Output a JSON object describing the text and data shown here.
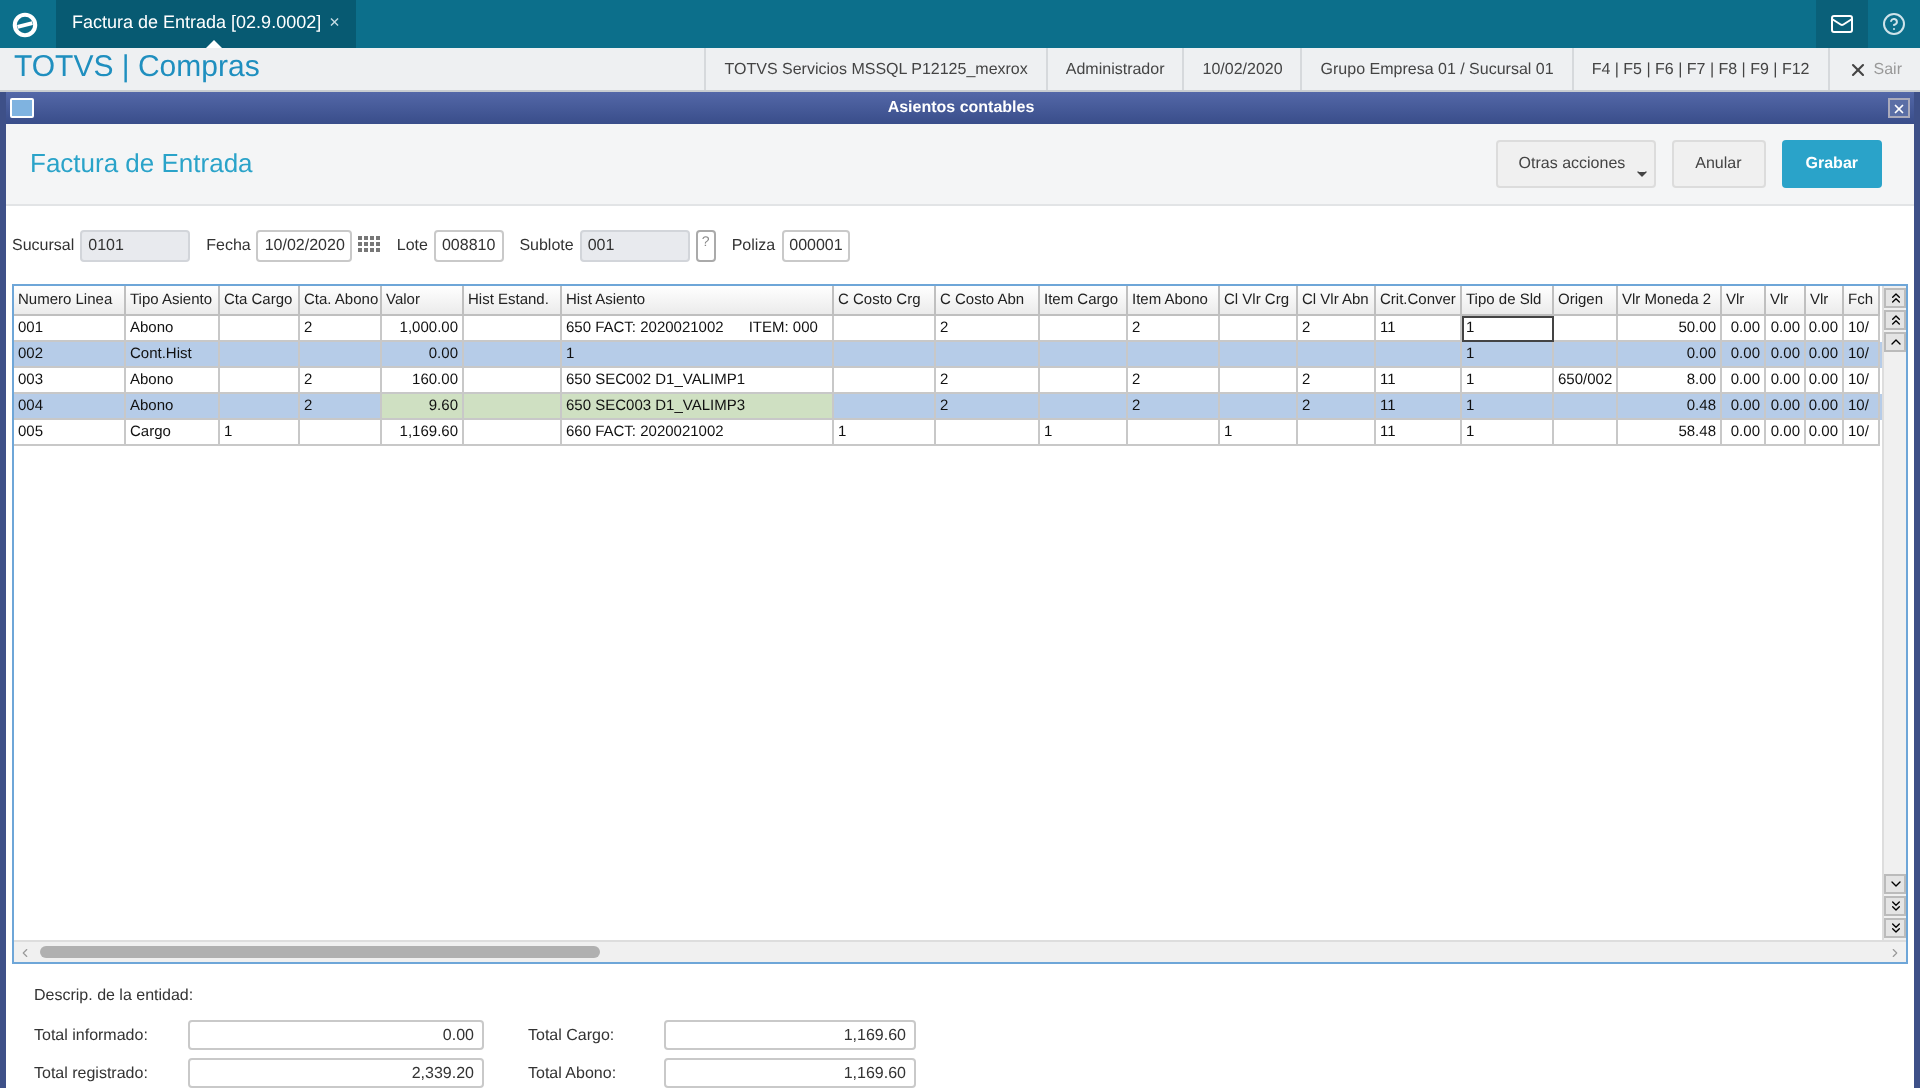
{
  "top_bar": {
    "tabs": [
      {
        "label": "Factura de Entrada [02.9.0002]",
        "close": "×",
        "selected": true
      }
    ]
  },
  "header": {
    "brand": "TOTVS | Compras",
    "info": [
      "TOTVS Servicios MSSQL P12125_mexrox",
      "Administrador",
      "10/02/2020",
      "Grupo Empresa 01 / Sucursal 01",
      "F4 | F5 | F6 | F7 | F8 | F9 | F12"
    ],
    "exit": "Sair"
  },
  "dialog": {
    "title": "Asientos contables",
    "heading": "Factura de Entrada",
    "buttons": [
      {
        "label": "Otras acciones",
        "kind": "menu"
      },
      {
        "label": "Anular",
        "kind": "plain"
      },
      {
        "label": "Grabar",
        "kind": "primary"
      }
    ],
    "fields": [
      {
        "label": "Sucursal",
        "value": "0101",
        "disabled": true,
        "kind": "text"
      },
      {
        "label": "Fecha",
        "value": "10/02/2020",
        "disabled": false,
        "kind": "date"
      },
      {
        "label": "Lote",
        "value": "008810",
        "disabled": false,
        "kind": "text"
      },
      {
        "label": "Sublote",
        "value": "001",
        "disabled": true,
        "kind": "lookup",
        "lookup": "?"
      },
      {
        "label": "Poliza",
        "value": "000001",
        "disabled": false,
        "kind": "text"
      }
    ],
    "table": {
      "columns": [
        "Numero Linea",
        "Tipo Asiento",
        "Cta Cargo",
        "Cta. Abono",
        "Valor",
        "Hist Estand.",
        "Hist Asiento",
        "C Costo Crg",
        "C Costo Abn",
        "Item Cargo",
        "Item Abono",
        "Cl Vlr Crg",
        "Cl Vlr Abn",
        "Crit.Conver",
        "Tipo de Sld",
        "Origen",
        "Vlr Moneda 2",
        "Vlr",
        "Vlr",
        "Vlr",
        "Fch"
      ],
      "rows": [
        {
          "selected": false,
          "drag_highlight": false,
          "cells": [
            "001",
            "Abono",
            "",
            "2",
            "1,000.00",
            "",
            "650 FACT: 2020021002      ITEM: 000",
            "",
            "2",
            "",
            "2",
            "",
            "2",
            "11",
            {
              "text": "1",
              "focused": true
            },
            "",
            "50.00",
            "0.00",
            "0.00",
            "0.00",
            "10/"
          ]
        },
        {
          "selected": true,
          "drag_highlight": false,
          "cells": [
            "002",
            "Cont.Hist",
            "",
            "",
            "0.00",
            "",
            "1",
            "",
            "",
            "",
            "",
            "",
            "",
            "",
            "1",
            "",
            "0.00",
            "0.00",
            "0.00",
            "0.00",
            "10/"
          ]
        },
        {
          "selected": false,
          "drag_highlight": false,
          "cells": [
            "003",
            "Abono",
            "",
            "2",
            "160.00",
            "",
            "650 SEC002 D1_VALIMP1",
            "",
            "2",
            "",
            "2",
            "",
            "2",
            "11",
            "1",
            "650/002",
            "8.00",
            "0.00",
            "0.00",
            "0.00",
            "10/"
          ]
        },
        {
          "selected": true,
          "drag_highlight": true,
          "cells": [
            "004",
            "Abono",
            "",
            "2",
            "9.60",
            "",
            "650 SEC003 D1_VALIMP3",
            "",
            "2",
            "",
            "2",
            "",
            "2",
            "11",
            "1",
            "",
            "0.48",
            "0.00",
            "0.00",
            "0.00",
            "10/"
          ]
        },
        {
          "selected": false,
          "drag_highlight": false,
          "cells": [
            "005",
            "Cargo",
            "1",
            "",
            "1,169.60",
            "",
            "660 FACT: 2020021002",
            "1",
            "",
            "1",
            "",
            "1",
            "",
            "11",
            "1",
            "",
            "58.48",
            "0.00",
            "0.00",
            "0.00",
            "10/"
          ]
        }
      ]
    },
    "description_label": "Descrip. de la entidad:",
    "totals": [
      {
        "label": "Total informado:",
        "value": "0.00"
      },
      {
        "label": "Total Cargo:",
        "value": "1,169.60"
      },
      {
        "label": "Total registrado:",
        "value": "2,339.20"
      },
      {
        "label": "Total Abono:",
        "value": "1,169.60"
      }
    ]
  }
}
